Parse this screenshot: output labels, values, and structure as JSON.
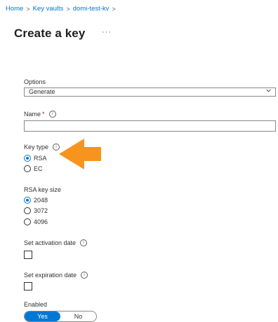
{
  "breadcrumb": {
    "items": [
      "Home",
      "Key vaults",
      "domi-test-kv"
    ]
  },
  "header": {
    "title": "Create a key",
    "more": "···"
  },
  "options": {
    "label": "Options",
    "value": "Generate"
  },
  "name": {
    "label": "Name",
    "required_mark": "*",
    "value": ""
  },
  "key_type": {
    "label": "Key type",
    "options": [
      "RSA",
      "EC"
    ],
    "selected": "RSA"
  },
  "rsa_key_size": {
    "label": "RSA key size",
    "options": [
      "2048",
      "3072",
      "4096"
    ],
    "selected": "2048"
  },
  "activation": {
    "label": "Set activation date"
  },
  "expiration": {
    "label": "Set expiration date"
  },
  "enabled": {
    "label": "Enabled",
    "yes": "Yes",
    "no": "No",
    "selected": "Yes"
  },
  "colors": {
    "accent": "#0078d4",
    "annotation_arrow": "#f7941d"
  },
  "info_icon": "i",
  "chevron_icon": "chevron-down-icon"
}
